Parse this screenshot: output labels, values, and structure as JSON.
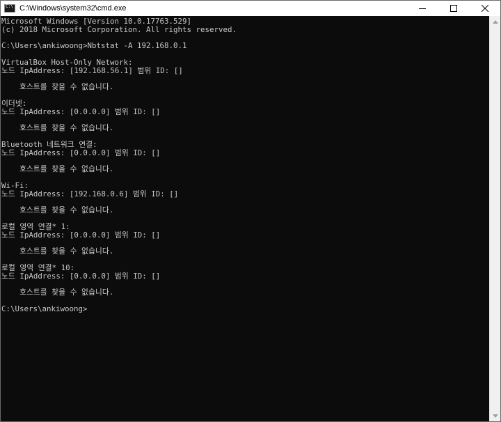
{
  "window": {
    "title": "C:\\Windows\\system32\\cmd.exe",
    "app_icon": "cmd-icon",
    "controls": [
      "minimize-icon",
      "maximize-icon",
      "close-icon"
    ]
  },
  "console": {
    "lines": [
      "Microsoft Windows [Version 10.0.17763.529]",
      "(c) 2018 Microsoft Corporation. All rights reserved.",
      "",
      "C:\\Users\\ankiwoong>Nbtstat -A 192.168.0.1",
      "",
      "VirtualBox Host-Only Network:",
      "노드 IpAddress: [192.168.56.1] 범위 ID: []",
      "",
      "    호스트를 찾을 수 없습니다.",
      "",
      "이더넷:",
      "노드 IpAddress: [0.0.0.0] 범위 ID: []",
      "",
      "    호스트를 찾을 수 없습니다.",
      "",
      "Bluetooth 네트워크 연결:",
      "노드 IpAddress: [0.0.0.0] 범위 ID: []",
      "",
      "    호스트를 찾을 수 없습니다.",
      "",
      "Wi-Fi:",
      "노드 IpAddress: [192.168.0.6] 범위 ID: []",
      "",
      "    호스트를 찾을 수 없습니다.",
      "",
      "로컬 영역 연결* 1:",
      "노드 IpAddress: [0.0.0.0] 범위 ID: []",
      "",
      "    호스트를 찾을 수 없습니다.",
      "",
      "로컬 영역 연결* 10:",
      "노드 IpAddress: [0.0.0.0] 범위 ID: []",
      "",
      "    호스트를 찾을 수 없습니다.",
      "",
      "C:\\Users\\ankiwoong>"
    ]
  },
  "colors": {
    "console_bg": "#0c0c0c",
    "console_text": "#c8c8c8",
    "titlebar_bg": "#ffffff"
  }
}
